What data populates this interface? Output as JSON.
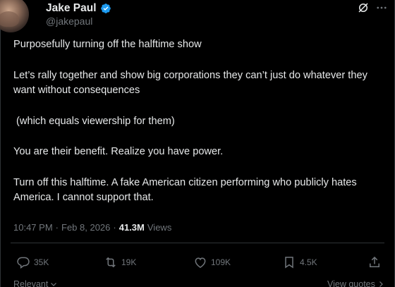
{
  "author": {
    "display_name": "Jake Paul",
    "handle": "@jakepaul",
    "verified": true
  },
  "tweet": {
    "paragraphs": [
      "Purposefully turning off the halftime show",
      "Let’s rally together and show big corporations they can’t just do whatever they want without consequences",
      " (which equals viewership for them)",
      "You are their benefit. Realize you have power.",
      "Turn off this halftime. A fake American citizen performing who publicly hates America. I cannot support that."
    ],
    "time": "10:47 PM",
    "separator": "·",
    "date": "Feb 8, 2026",
    "separator2": "·",
    "views_count": "41.3M",
    "views_label": "Views"
  },
  "actions": {
    "reply_count": "35K",
    "retweet_count": "19K",
    "like_count": "109K",
    "bookmark_count": "4.5K"
  },
  "footer": {
    "sort_label": "Relevant",
    "quotes_label": "View quotes"
  },
  "colors": {
    "background": "#000000",
    "text": "#e7e9ea",
    "muted": "#71767b",
    "verified_blue": "#1d9bf0",
    "divider": "#2f3336"
  },
  "icons": [
    "verified-badge-icon",
    "grok-icon",
    "more-icon",
    "reply-icon",
    "retweet-icon",
    "like-icon",
    "bookmark-icon",
    "share-icon",
    "chevron-down-icon",
    "chevron-right-icon"
  ]
}
